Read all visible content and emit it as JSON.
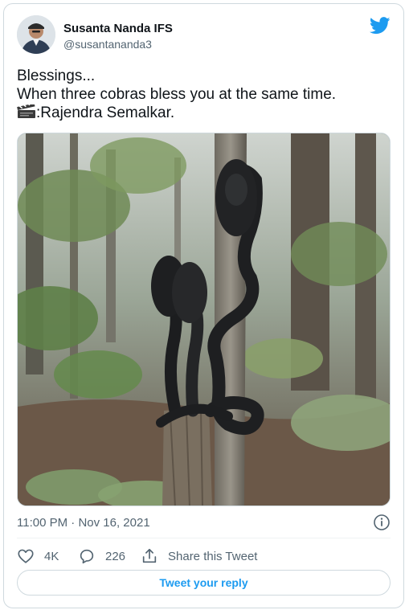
{
  "author": {
    "display_name": "Susanta Nanda IFS",
    "handle": "@susantananda3"
  },
  "tweet": {
    "line1": "Blessings...",
    "line2": "When three cobras bless you at the same time.",
    "line3_text": ":Rajendra Semalkar.",
    "line3_icon": "clapper-board-icon"
  },
  "media": {
    "icon": "photo"
  },
  "meta": {
    "time": "11:00 PM",
    "separator": " · ",
    "date": "Nov 16, 2021"
  },
  "actions": {
    "like_count": "4K",
    "reply_count": "226",
    "share_label": "Share this Tweet"
  },
  "reply_button": {
    "label": "Tweet your reply"
  },
  "colors": {
    "twitter_blue": "#1d9bf0",
    "secondary_text": "#536471",
    "border": "#cfd9de"
  }
}
